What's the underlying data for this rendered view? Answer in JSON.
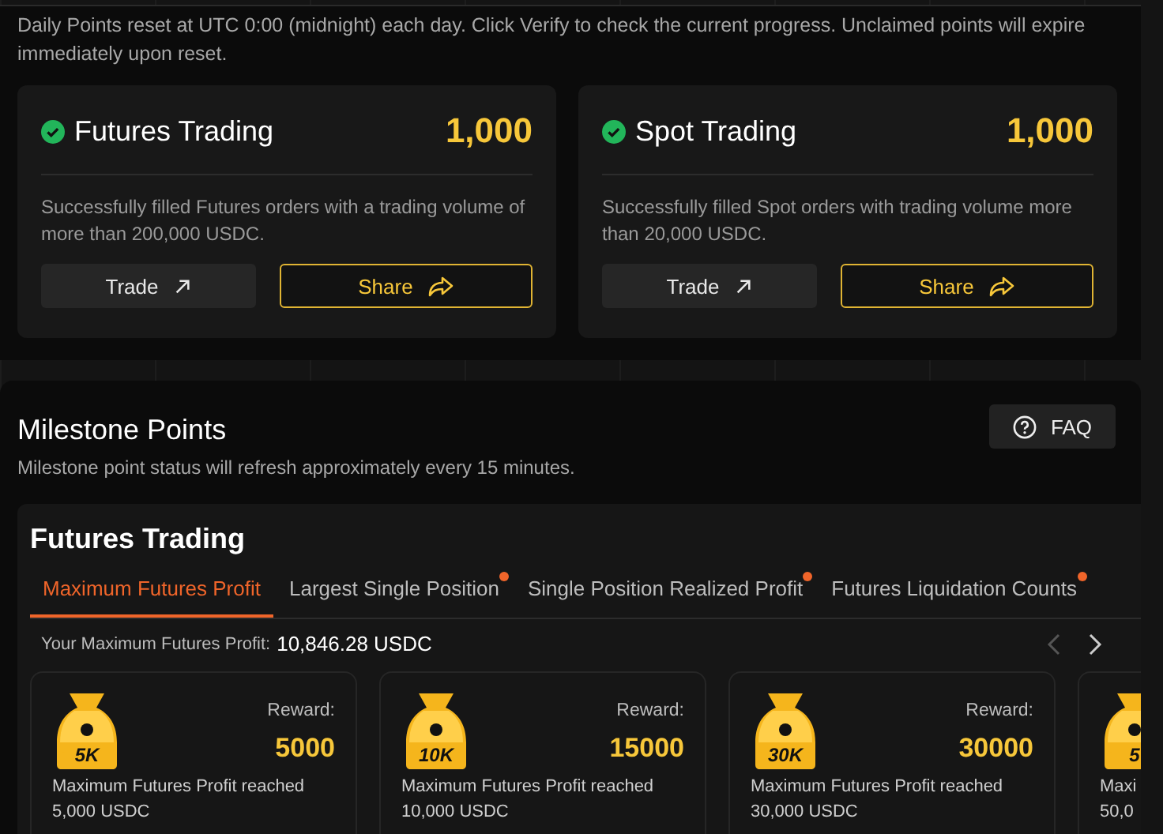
{
  "daily": {
    "notice": "Daily Points reset at UTC 0:00 (midnight) each day. Click Verify to check the current progress. Unclaimed points will expire immediately upon reset.",
    "tasks": [
      {
        "title": "Futures Trading",
        "completed": true,
        "points": "1,000",
        "description": "Successfully filled Futures orders with a trading volume of more than 200,000 USDC.",
        "trade_label": "Trade",
        "share_label": "Share"
      },
      {
        "title": "Spot Trading",
        "completed": true,
        "points": "1,000",
        "description": "Successfully filled Spot orders with trading volume more than 20,000 USDC.",
        "trade_label": "Trade",
        "share_label": "Share"
      }
    ]
  },
  "milestone": {
    "title": "Milestone Points",
    "subtitle": "Milestone point status will refresh approximately every 15 minutes.",
    "faq_label": "FAQ",
    "section_title": "Futures Trading",
    "tabs": [
      {
        "label": "Maximum Futures Profit",
        "selected": true,
        "dot": false
      },
      {
        "label": "Largest Single Position",
        "selected": false,
        "dot": true
      },
      {
        "label": "Single Position Realized Profit",
        "selected": false,
        "dot": true
      },
      {
        "label": "Futures Liquidation Counts",
        "selected": false,
        "dot": true
      }
    ],
    "profit_label": "Your Maximum Futures Profit:",
    "profit_value": "10,846.28 USDC",
    "rewards": [
      {
        "badge": "5K",
        "reward_label": "Reward:",
        "reward": "5000",
        "lines": [
          "Maximum Futures Profit reached",
          "5,000 USDC"
        ]
      },
      {
        "badge": "10K",
        "reward_label": "Reward:",
        "reward": "15000",
        "lines": [
          "Maximum Futures Profit reached",
          "10,000 USDC"
        ]
      },
      {
        "badge": "30K",
        "reward_label": "Reward:",
        "reward": "30000",
        "lines": [
          "Maximum Futures Profit reached",
          "30,000 USDC"
        ]
      },
      {
        "badge": "5",
        "lines": [
          "Maxi",
          "50,0"
        ]
      }
    ]
  }
}
